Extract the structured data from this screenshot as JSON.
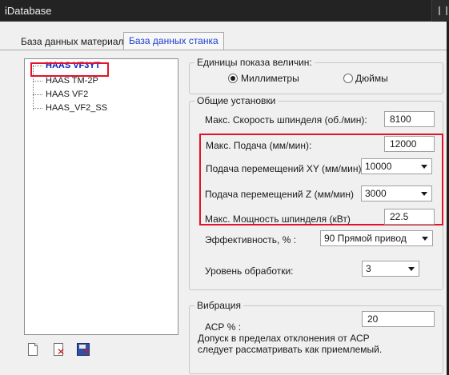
{
  "window": {
    "title": "iDatabase"
  },
  "tabs": [
    {
      "label": "База данных материала",
      "active": false
    },
    {
      "label": "База данных станка",
      "active": true
    }
  ],
  "tree": {
    "items": [
      {
        "label": "HAAS VF3YT",
        "selected": true
      },
      {
        "label": "HAAS TM-2P",
        "selected": false
      },
      {
        "label": "HAAS VF2",
        "selected": false
      },
      {
        "label": "HAAS_VF2_SS",
        "selected": false
      }
    ]
  },
  "toolbar_icons": [
    "new-document-icon",
    "delete-document-icon",
    "save-icon"
  ],
  "units": {
    "title": "Единицы показа величин:",
    "options": [
      {
        "label": "Миллиметры",
        "checked": true
      },
      {
        "label": "Дюймы",
        "checked": false
      }
    ]
  },
  "general": {
    "title": "Общие установки",
    "max_spindle_speed": {
      "label": "Макс. Скорость шпинделя (об./мин):",
      "value": "8100"
    },
    "max_feed": {
      "label": "Макс. Подача (мм/мин):",
      "value": "12000"
    },
    "rapid_xy": {
      "label": "Подача перемещений XY (мм/мин):",
      "value": "10000"
    },
    "rapid_z": {
      "label": "Подача перемещений Z (мм/мин)",
      "value": "3000"
    },
    "max_spindle_power": {
      "label": "Макс. Мощность шпинделя (кВт)",
      "value": "22.5"
    },
    "efficiency": {
      "label": "Эффективность, % :",
      "value": "90 Прямой привод"
    },
    "machining_level": {
      "label": "Уровень обработки:",
      "value": "3"
    }
  },
  "vibration": {
    "title": "Вибрация",
    "acp": {
      "label": "АСР % :",
      "value": "20"
    },
    "note_line1": "Допуск  в пределах отклонения от АСР",
    "note_line2": "следует рассматривать как приемлемый."
  },
  "colors": {
    "highlight_box": "#e3122a",
    "selected_item": "#0b1fb8",
    "active_tab_text": "#1c3fd0",
    "dialog_bg": "#f0f0f0",
    "titlebar_bg": "#232323"
  }
}
